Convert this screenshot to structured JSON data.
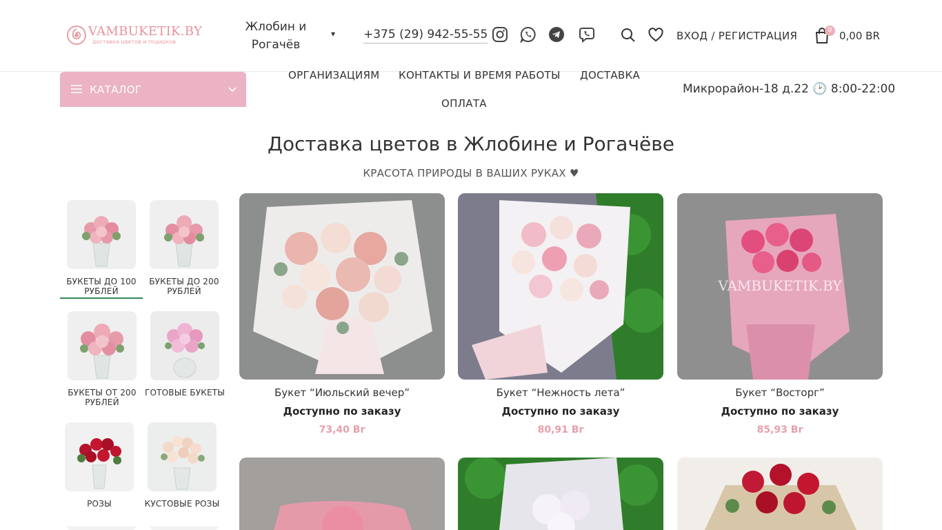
{
  "brand": {
    "logo_title": "VAMBUKETIK.BY",
    "logo_subtitle": "доставка цветов и подарков",
    "accent_color": "#ebb3c3",
    "price_color": "#e8a0aa"
  },
  "header": {
    "city": "Жлобин и Рогачёв",
    "city_arrow": "▾",
    "phone": "+375 (29) 942-55-55",
    "social_icons": [
      "instagram-icon",
      "whatsapp-icon",
      "telegram-icon",
      "viber-icon"
    ],
    "login": "ВХОД / РЕГИСТРАЦИЯ",
    "cart_count": "0",
    "cart_total": "0,00 BR"
  },
  "nav": {
    "catalog_label": "КАТАЛОГ",
    "links": [
      "ОРГАНИЗАЦИЯМ",
      "КОНТАКТЫ И ВРЕМЯ РАБОТЫ",
      "ДОСТАВКА",
      "ОПЛАТА"
    ],
    "address": "Микрорайон-18 д.22 🕑 8:00-22:00"
  },
  "page": {
    "title": "Доставка цветов в Жлобине и Рогачёве",
    "subtitle": "КРАСОТА ПРИРОДЫ В ВАШИХ РУКАХ ♥"
  },
  "categories": [
    {
      "label": "БУКЕТЫ ДО 100 РУБЛЕЙ",
      "active": true
    },
    {
      "label": "БУКЕТЫ ДО 200 РУБЛЕЙ",
      "active": false
    },
    {
      "label": "БУКЕТЫ ОТ 200 РУБЛЕЙ",
      "active": false
    },
    {
      "label": "ГОТОВЫЕ БУКЕТЫ",
      "active": false
    },
    {
      "label": "РОЗЫ",
      "active": false
    },
    {
      "label": "КУСТОВЫЕ РОЗЫ",
      "active": false
    }
  ],
  "products": [
    {
      "name": "Букет “Июльский вечер”",
      "availability": "Доступно по заказу",
      "price": "73,40 Br"
    },
    {
      "name": "Букет “Нежность лета”",
      "availability": "Доступно по заказу",
      "price": "80,91 Br"
    },
    {
      "name": "Букет “Восторг”",
      "availability": "Доступно по заказу",
      "price": "85,93 Br",
      "watermark": "VAMBUKETIK.BY"
    }
  ]
}
